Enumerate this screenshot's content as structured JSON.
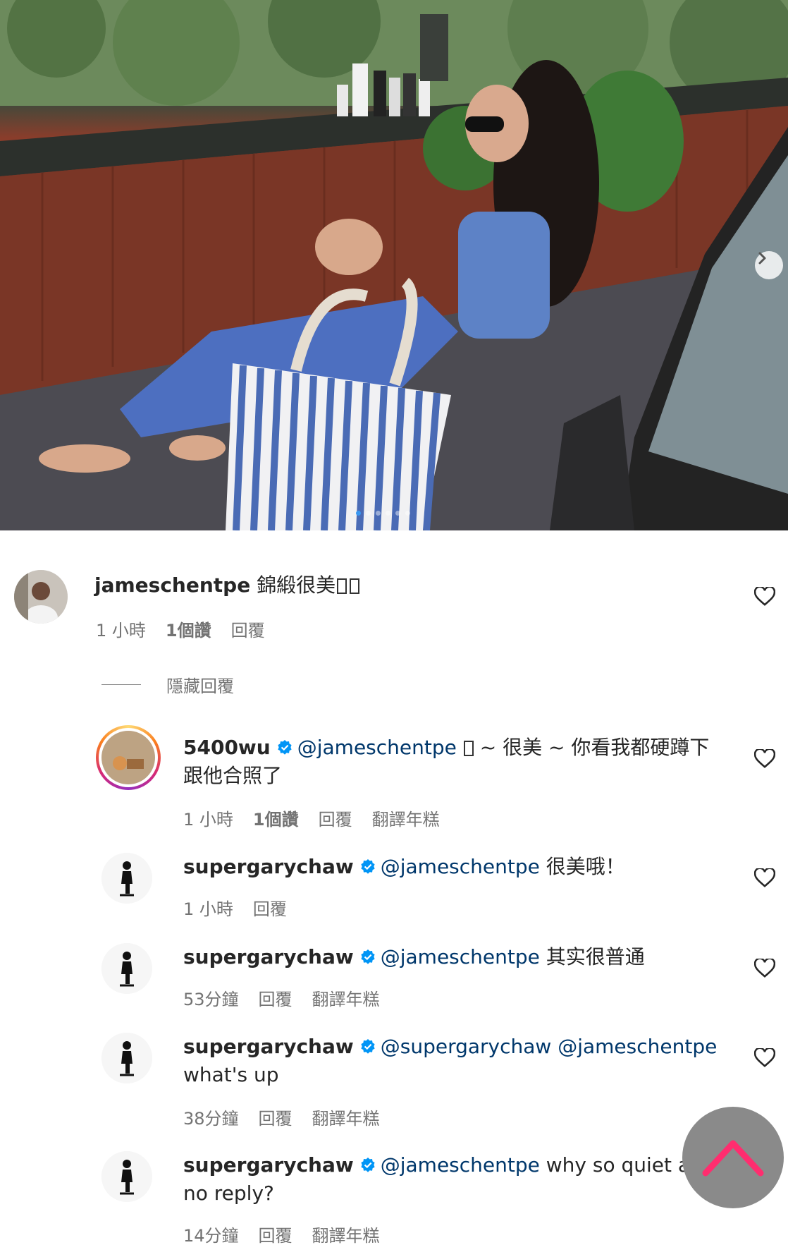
{
  "post": {
    "carousel_dots": 6,
    "active_dot": 0
  },
  "comments": [
    {
      "username": "jameschentpe",
      "text": " 錦緞很美",
      "time": "1 小時",
      "likes": "1個讚",
      "reply": "回覆"
    }
  ],
  "hide_replies_label": "隱藏回覆",
  "replies": [
    {
      "username": "5400wu",
      "mention": "@jameschentpe",
      "text_line1": " ~ 很美 ~ 你看我都硬蹲下",
      "text_line2": "跟他合照了",
      "time": "1 小時",
      "likes": "1個讚",
      "reply": "回覆",
      "translate": "翻譯年糕"
    },
    {
      "username": "supergarychaw",
      "mention": "@jameschentpe",
      "text_line1": " 很美哦！",
      "time": "1 小時",
      "reply": "回覆"
    },
    {
      "username": "supergarychaw",
      "mention": "@jameschentpe",
      "text_line1": " 其实很普通",
      "time": "53分鐘",
      "reply": "回覆",
      "translate": "翻譯年糕"
    },
    {
      "username": "supergarychaw",
      "mention": "@supergarychaw @jameschentpe",
      "text_line2": "what's up",
      "time": "38分鐘",
      "reply": "回覆",
      "translate": "翻譯年糕"
    },
    {
      "username": "supergarychaw",
      "mention": "@jameschentpe",
      "text_line1": " why so quiet and",
      "text_line2": "no reply?",
      "time": "14分鐘",
      "reply": "回覆",
      "translate": "翻譯年糕"
    }
  ],
  "colors": {
    "mention": "#00376b",
    "meta": "#737373",
    "verified": "#0095f6",
    "scroll_arrow": "#ff2d6f"
  }
}
